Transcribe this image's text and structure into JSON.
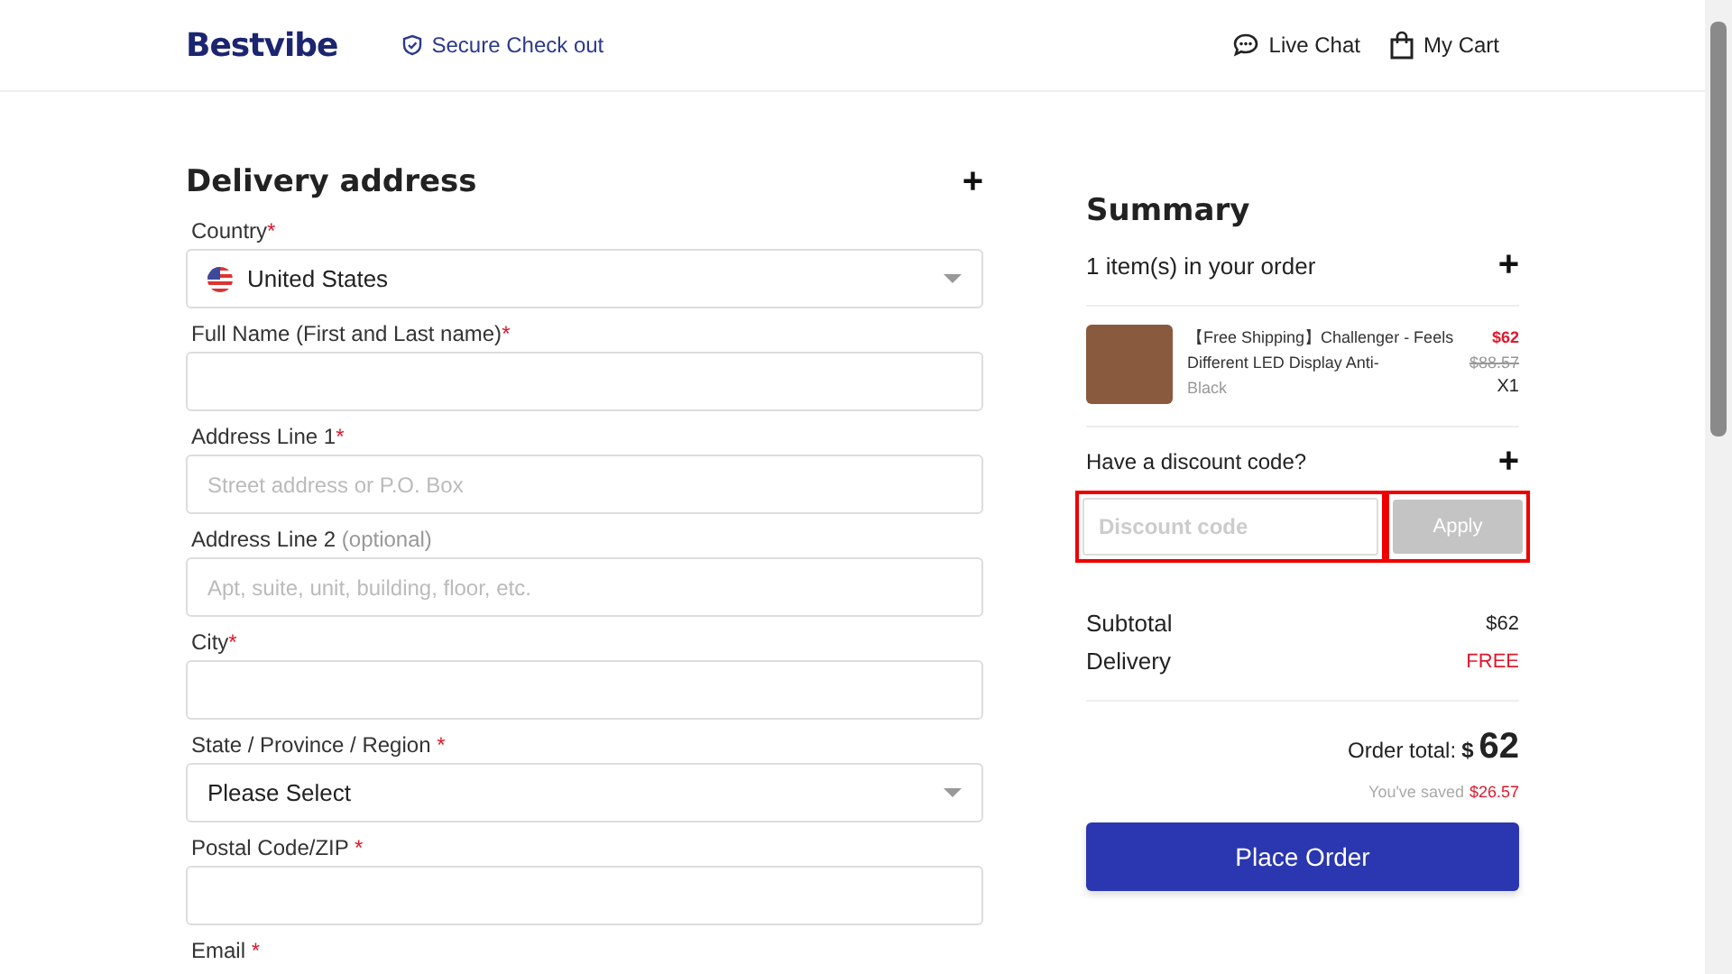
{
  "header": {
    "logo": "Bestvibe",
    "secure": "Secure Check out",
    "live_chat": "Live Chat",
    "cart": "My Cart"
  },
  "delivery": {
    "title": "Delivery address",
    "expand": "+",
    "fields": [
      {
        "kind": "select",
        "label": "Country",
        "mark": "*",
        "value": "United States",
        "flag": true
      },
      {
        "kind": "text",
        "label": "Full Name (First and Last name)",
        "mark": "*"
      },
      {
        "kind": "text",
        "label": "Address Line 1",
        "mark": "*",
        "placeholder": "Street address or P.O. Box"
      },
      {
        "kind": "text",
        "label": "Address Line 2",
        "note": "(optional)",
        "placeholder": "Apt, suite, unit, building, floor, etc."
      },
      {
        "kind": "text",
        "label": "City",
        "mark": "*"
      },
      {
        "kind": "select",
        "label": "State / Province / Region",
        "mark": " *",
        "value": "Please Select"
      },
      {
        "kind": "text",
        "label": "Postal Code/ZIP",
        "mark": " *"
      },
      {
        "kind": "cut",
        "label": "Email",
        "mark": " *"
      }
    ]
  },
  "summary": {
    "title": "Summary",
    "items_count": "1 item(s) in your order",
    "expand": "+",
    "item": {
      "name": "【Free Shipping】Challenger - Feels Different LED Display Anti-",
      "variant": "Black",
      "price": "$62",
      "old_price": "$88.57",
      "qty": "X1"
    },
    "discount": {
      "label": "Have a discount code?",
      "expand": "+",
      "placeholder": "Discount code",
      "button": "Apply",
      "highlighted": true
    },
    "subtotal_label": "Subtotal",
    "subtotal": "$62",
    "delivery_label": "Delivery",
    "delivery": "FREE",
    "total_label": "Order total:",
    "currency": "$",
    "total": "62",
    "saved_label": "You've saved",
    "saved": "$26.57",
    "place_order": "Place Order"
  }
}
